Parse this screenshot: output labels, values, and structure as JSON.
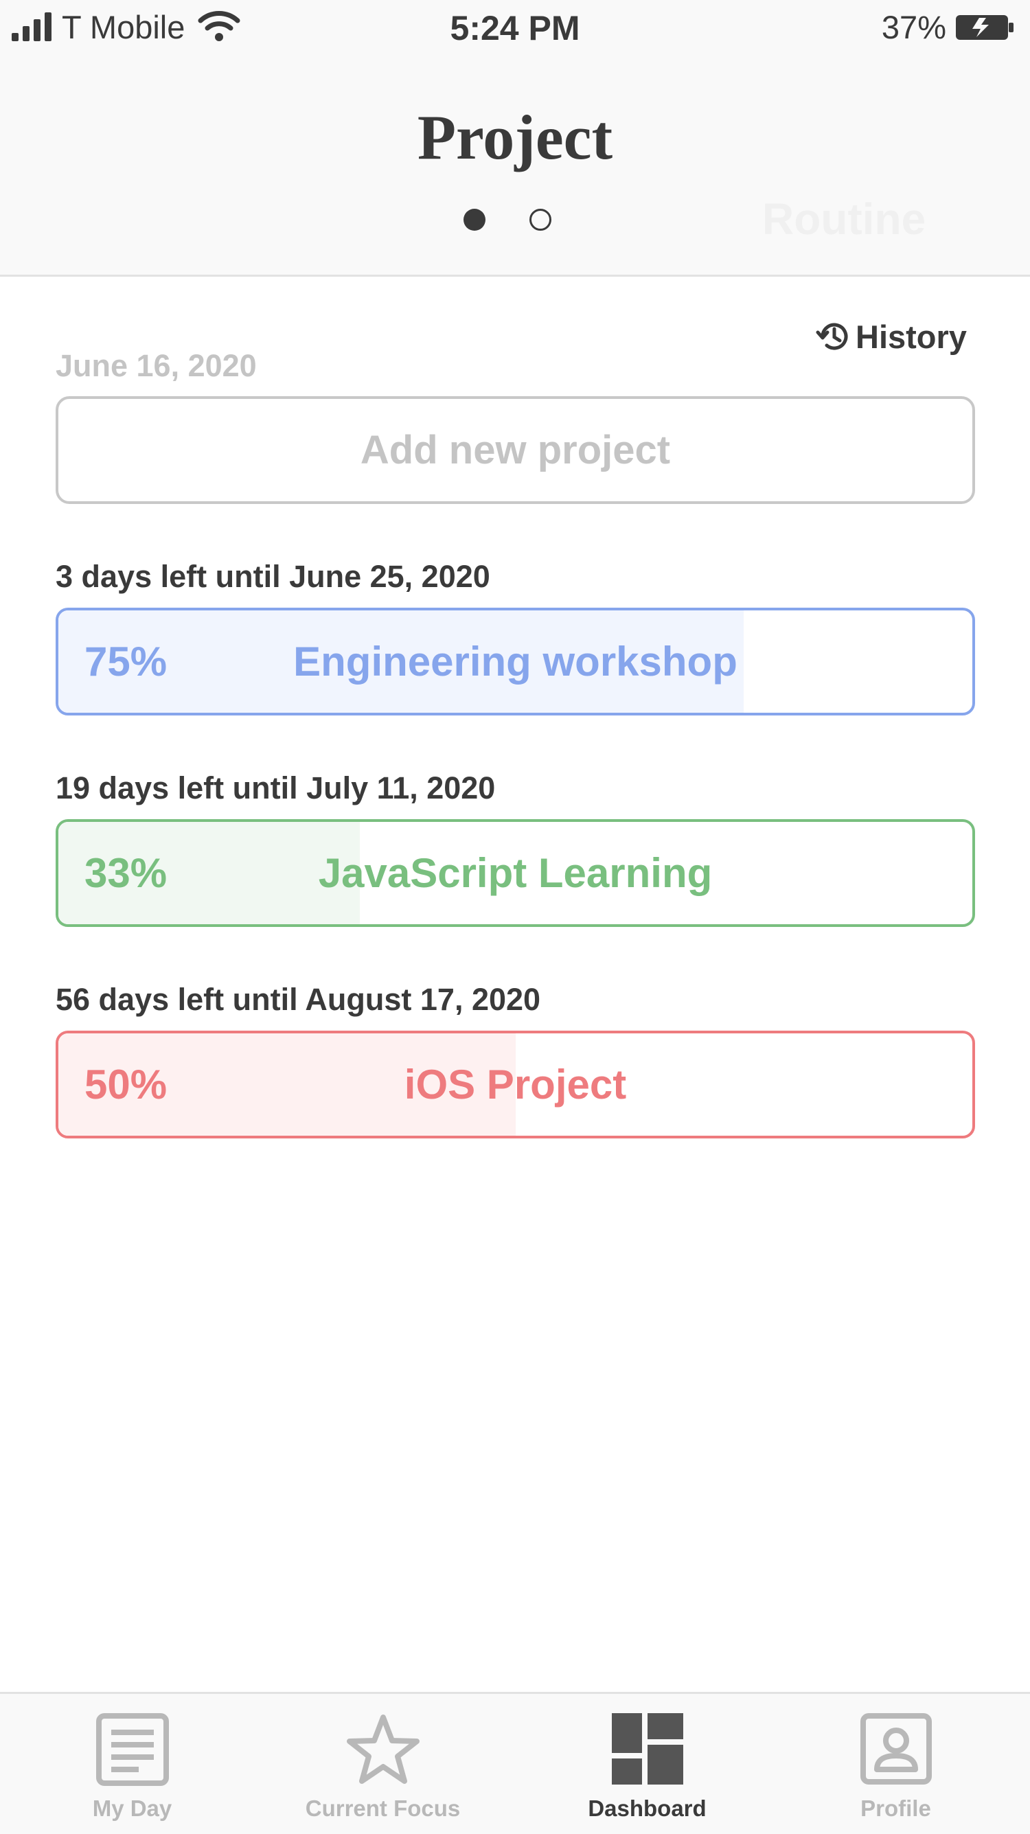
{
  "status_bar": {
    "carrier": "T Mobile",
    "time": "5:24 PM",
    "battery": "37%"
  },
  "header": {
    "title": "Project",
    "next_page_title": "Routine",
    "page_indicator": {
      "pages": 2,
      "active": 1
    }
  },
  "content": {
    "history_label": "History",
    "today_date": "June 16, 2020",
    "add_button_label": "Add new project",
    "projects": [
      {
        "deadline_text": "3 days left until June 25, 2020",
        "percent_label": "75%",
        "progress": 0.75,
        "name": "Engineering workshop",
        "color": "#86a5ec",
        "fill_color": "#f1f5fe"
      },
      {
        "deadline_text": "19 days left until July 11, 2020",
        "percent_label": "33%",
        "progress": 0.33,
        "name": "JavaScript Learning",
        "color": "#79bf7f",
        "fill_color": "#f1f8f2"
      },
      {
        "deadline_text": "56 days left until August 17, 2020",
        "percent_label": "50%",
        "progress": 0.5,
        "name": "iOS Project",
        "color": "#ee7b7e",
        "fill_color": "#fef1f1"
      }
    ]
  },
  "tab_bar": {
    "tabs": [
      {
        "label": "My Day",
        "icon": "document-icon",
        "active": false
      },
      {
        "label": "Current Focus",
        "icon": "star-icon",
        "active": false
      },
      {
        "label": "Dashboard",
        "icon": "dashboard-icon",
        "active": true
      },
      {
        "label": "Profile",
        "icon": "profile-icon",
        "active": false
      }
    ]
  }
}
